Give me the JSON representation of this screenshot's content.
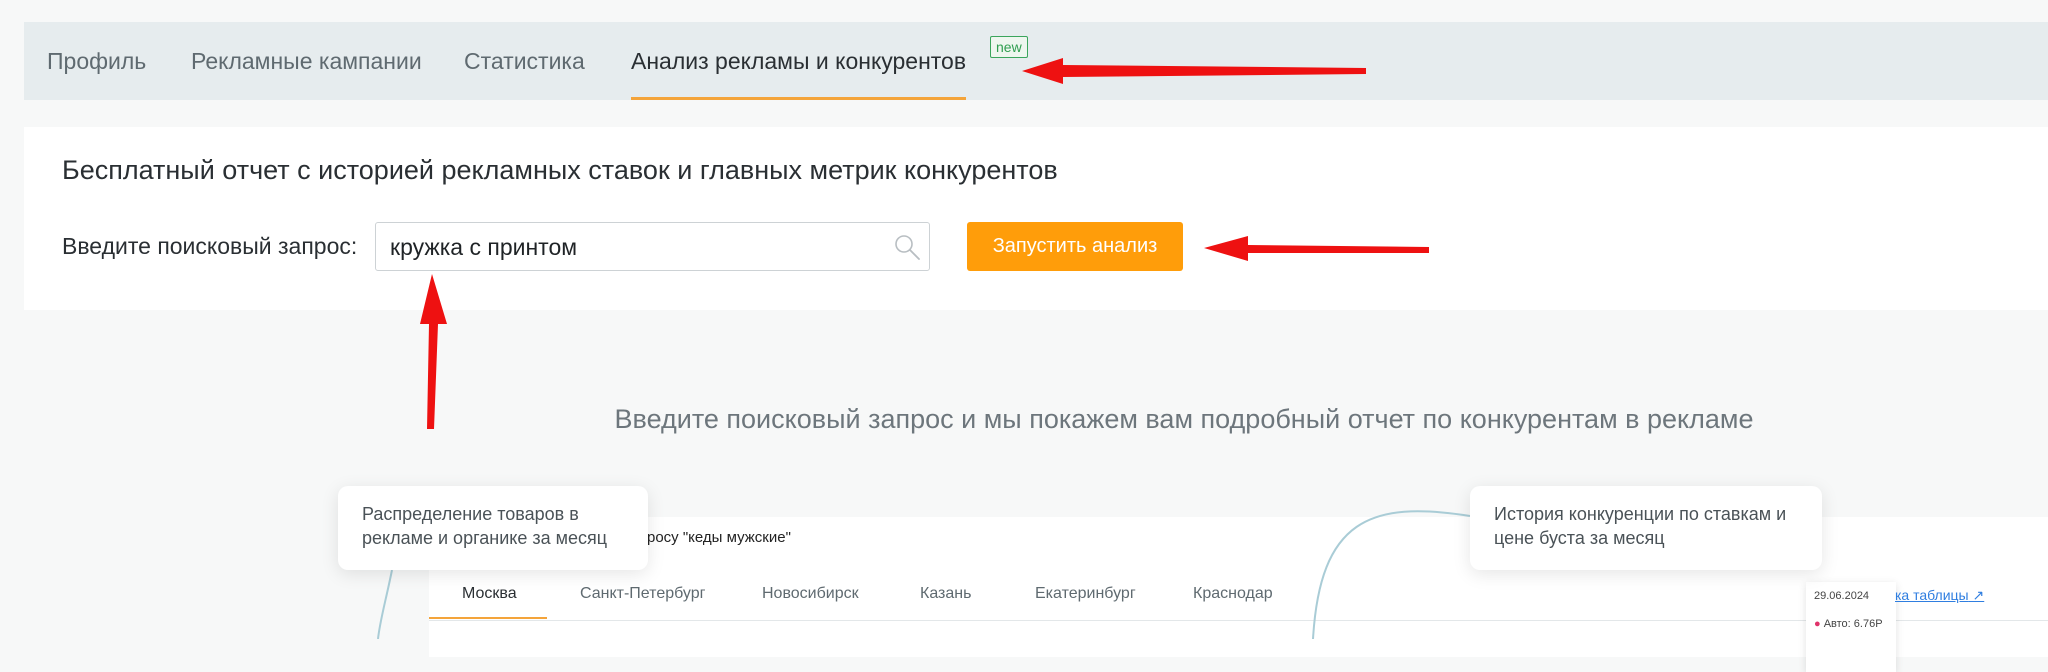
{
  "tabs": [
    {
      "label": "Профиль"
    },
    {
      "label": "Рекламные кампании"
    },
    {
      "label": "Статистика"
    },
    {
      "label": "Анализ рекламы и конкурентов",
      "badge": "new",
      "active": true
    }
  ],
  "report": {
    "title": "Бесплатный отчет с историей рекламных ставок и главных метрик конкурентов",
    "search_label": "Введите поисковый запрос:",
    "search_value": "кружка с принтом",
    "run_button": "Запустить анализ"
  },
  "promo": {
    "text": "Введите поисковый запрос и мы покажем вам подробный отчет по конкурентам в рекламе"
  },
  "preview": {
    "query_text": "росу \"кеды мужские\"",
    "cities": [
      "Москва",
      "Санкт-Петербург",
      "Новосибирск",
      "Казань",
      "Екатеринбург",
      "Краснодар"
    ],
    "table_link": "ка таблицы",
    "tooltip_date": "29.06.2024",
    "tooltip_auto": "Авто: 6.76Р"
  },
  "callouts": {
    "left": "Распределение товаров в рекламе и органике за месяц",
    "right": "История конкуренции по ставкам и цене буста за месяц"
  },
  "colors": {
    "accent": "#ff9d0a",
    "tab_underline": "#f4a43a",
    "badge": "#3ba55c",
    "annotation_arrow": "#ee1111"
  }
}
